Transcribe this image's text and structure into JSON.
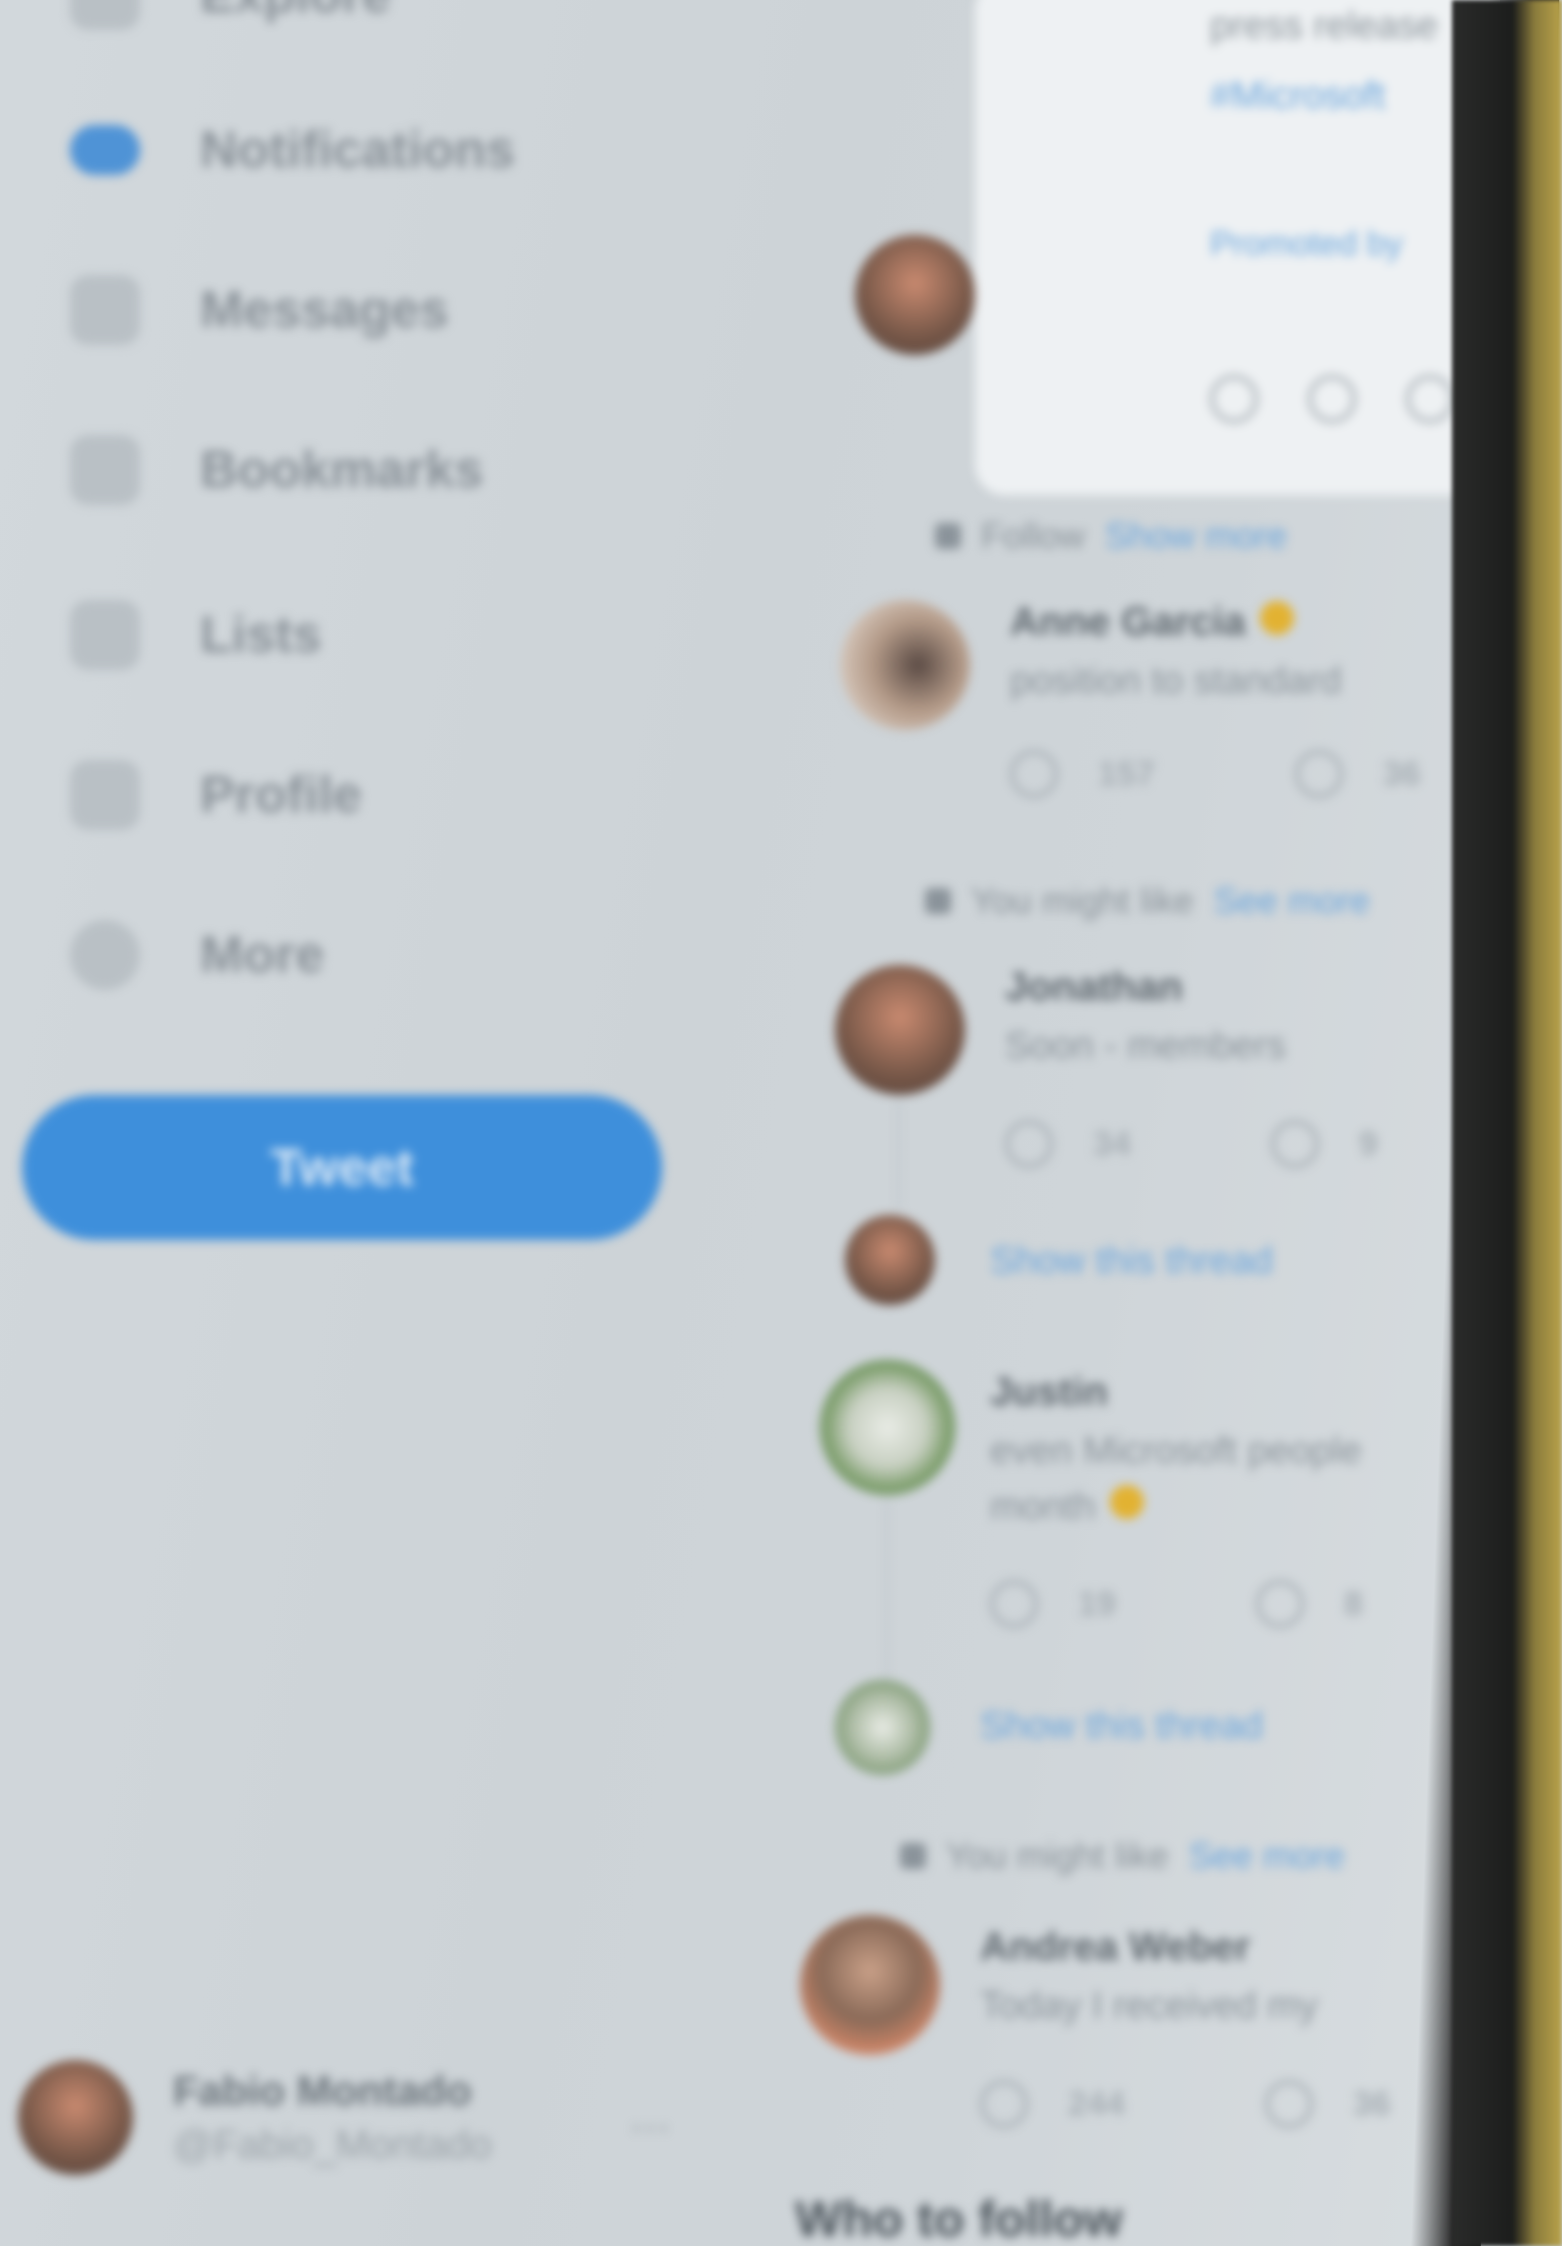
{
  "sidebar": {
    "items": [
      {
        "label": "Explore"
      },
      {
        "label": "Notifications"
      },
      {
        "label": "Messages"
      },
      {
        "label": "Bookmarks"
      },
      {
        "label": "Lists"
      },
      {
        "label": "Profile"
      },
      {
        "label": "More"
      }
    ],
    "tweet_button": "Tweet",
    "account": {
      "name": "Fabio Montado",
      "handle": "@Fabio_Montado"
    }
  },
  "timeline": {
    "card": {
      "line1": "press release",
      "link": "#Microsoft",
      "footer": "Promoted by"
    },
    "items": [
      {
        "context": "Follow",
        "context_link": "Show more",
        "name": "Anne Garcia",
        "text": "position to standard",
        "replies": "157",
        "retweets": "36"
      },
      {
        "context": "You might like",
        "context_link": "See more",
        "name": "Jonathan",
        "text": "Soon - members",
        "replies": "34",
        "retweets": "9"
      },
      {
        "show_thread": "Show this thread"
      },
      {
        "name": "Justin",
        "text": "even Microsoft people",
        "text2": "month",
        "replies": "19",
        "retweets": "8"
      },
      {
        "show_thread": "Show this thread"
      },
      {
        "context": "You might like",
        "context_link": "See more",
        "name": "Andrea Weber",
        "text": "Today I received my",
        "replies": "244",
        "retweets": "36"
      }
    ],
    "who_to_follow": "Who to follow"
  },
  "colors": {
    "accent": "#3e8fdb",
    "bezel": "#1c1d1c"
  }
}
